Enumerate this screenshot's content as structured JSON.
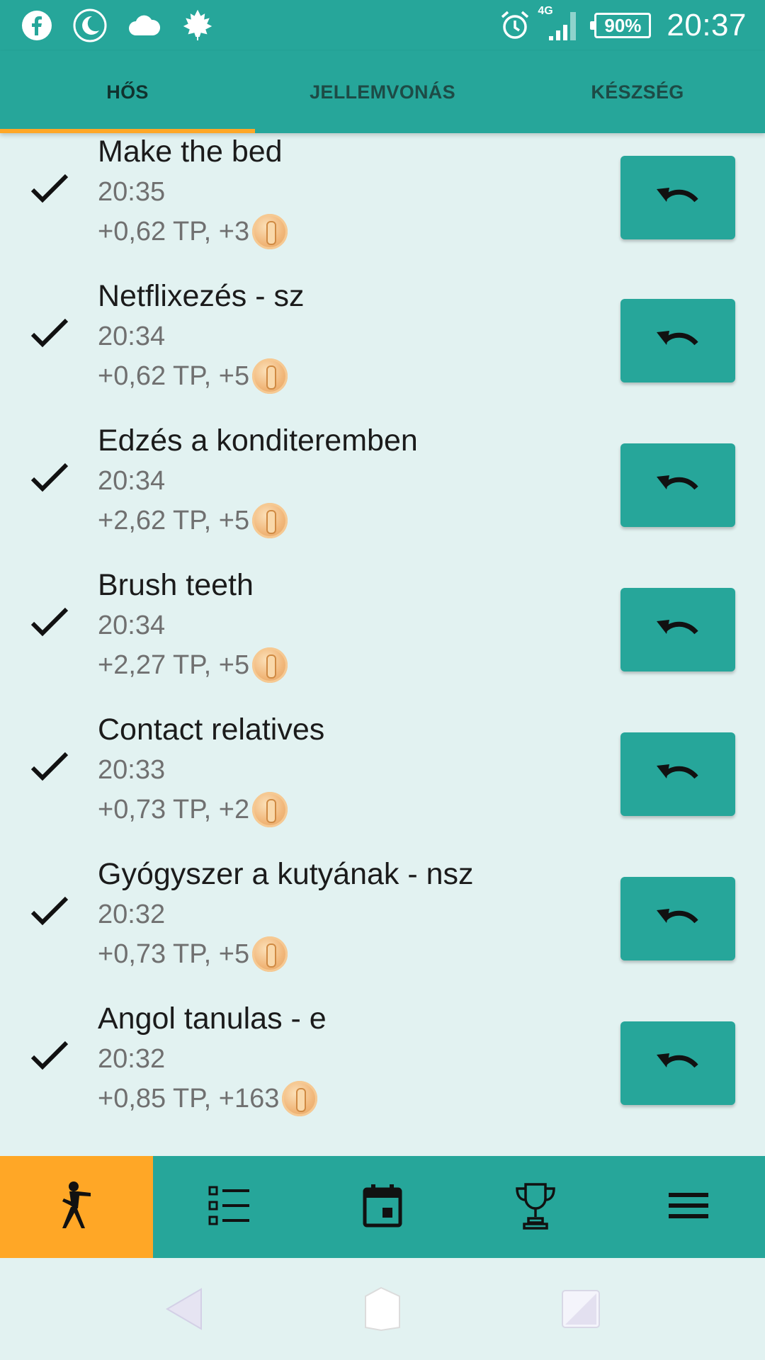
{
  "status_bar": {
    "network_label": "4G",
    "battery": "90%",
    "time": "20:37",
    "icons": [
      "facebook-icon",
      "moon-icon",
      "cloud-icon",
      "maple-leaf-icon",
      "alarm-icon",
      "signal-icon"
    ]
  },
  "tabs": [
    {
      "label": "HŐS",
      "active": true
    },
    {
      "label": "JELLEMVONÁS",
      "active": false
    },
    {
      "label": "KÉSZSÉG",
      "active": false
    }
  ],
  "list": {
    "items": [
      {
        "title": "Make the bed",
        "time": "20:35",
        "reward": "+0,62 TP, +3"
      },
      {
        "title": "Netflixezés - sz",
        "time": "20:34",
        "reward": "+0,62 TP, +5"
      },
      {
        "title": "Edzés a konditeremben",
        "time": "20:34",
        "reward": "+2,62 TP, +5"
      },
      {
        "title": "Brush teeth",
        "time": "20:34",
        "reward": "+2,27 TP, +5"
      },
      {
        "title": "Contact relatives",
        "time": "20:33",
        "reward": "+0,73 TP, +2"
      },
      {
        "title": "Gyógyszer a kutyának - nsz",
        "time": "20:32",
        "reward": "+0,73 TP, +5"
      },
      {
        "title": "Angol tanulas - e",
        "time": "20:32",
        "reward": "+0,85 TP, +163"
      }
    ]
  },
  "bottom_nav": {
    "items": [
      "hero-icon",
      "checklist-icon",
      "calendar-icon",
      "trophy-icon",
      "menu-icon"
    ],
    "active_index": 0
  },
  "colors": {
    "primary": "#26a69a",
    "accent": "#ffa726",
    "background": "#e2f2f1"
  }
}
